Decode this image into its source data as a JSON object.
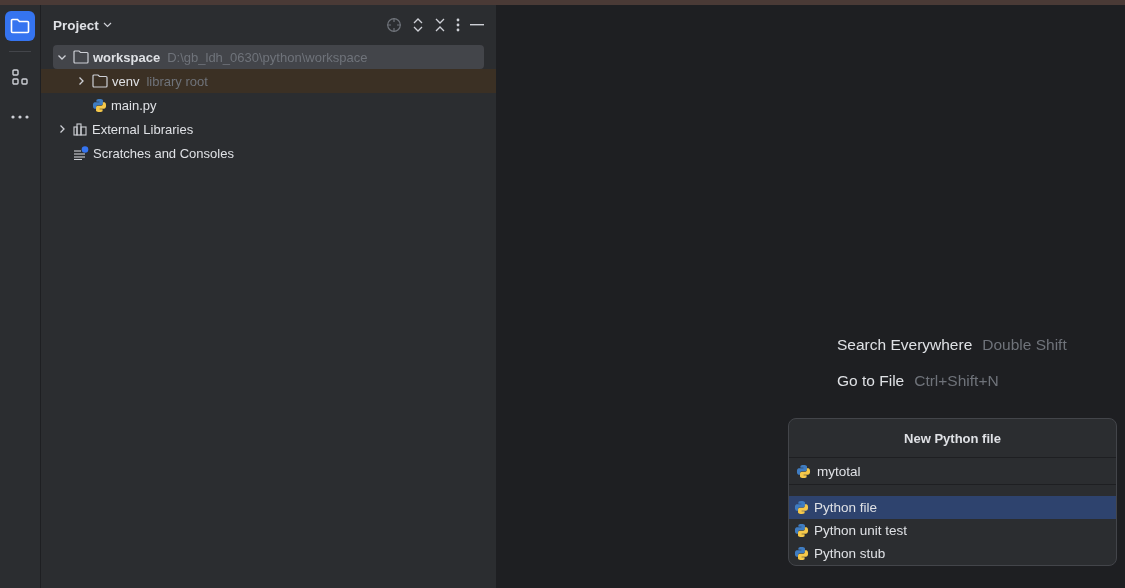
{
  "toolbar": {
    "items": [
      {
        "kind": "project",
        "selected": true
      },
      {
        "kind": "structure",
        "selected": false
      },
      {
        "kind": "more",
        "selected": false
      }
    ]
  },
  "panel": {
    "title": "Project"
  },
  "tree": [
    {
      "kind": "folder",
      "name": "workspace",
      "hint": "D:\\gb_ldh_0630\\python\\workspace",
      "expanded": true,
      "selected": true,
      "highlighted": false,
      "children": [
        {
          "kind": "folder",
          "name": "venv",
          "hint": "library root",
          "expanded": false,
          "selected": false,
          "highlighted": true
        },
        {
          "kind": "python",
          "name": "main.py",
          "selected": false,
          "highlighted": false
        }
      ]
    },
    {
      "kind": "libraries",
      "name": "External Libraries",
      "expanded": false,
      "selected": false,
      "highlighted": false
    },
    {
      "kind": "scratches",
      "name": "Scratches and Consoles",
      "selected": false,
      "highlighted": false
    }
  ],
  "hints": [
    {
      "action": "Search Everywhere",
      "shortcut": "Double Shift"
    },
    {
      "action": "Go to File",
      "shortcut": "Ctrl+Shift+N"
    }
  ],
  "popup": {
    "title": "New Python file",
    "input": {
      "value": "mytotal"
    },
    "options": [
      {
        "label": "Python file",
        "selected": true
      },
      {
        "label": "Python unit test",
        "selected": false
      },
      {
        "label": "Python stub",
        "selected": false
      }
    ]
  }
}
